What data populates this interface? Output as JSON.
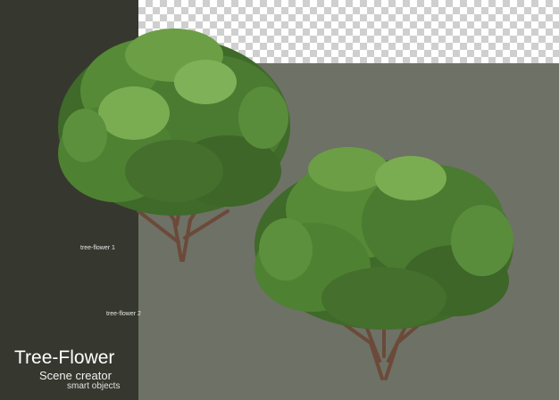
{
  "labels": {
    "tree1": "tree-flower 1",
    "tree2": "tree-flower 2"
  },
  "title": "Tree-Flower",
  "subtitle": "Scene creator",
  "caption": "smart objects"
}
